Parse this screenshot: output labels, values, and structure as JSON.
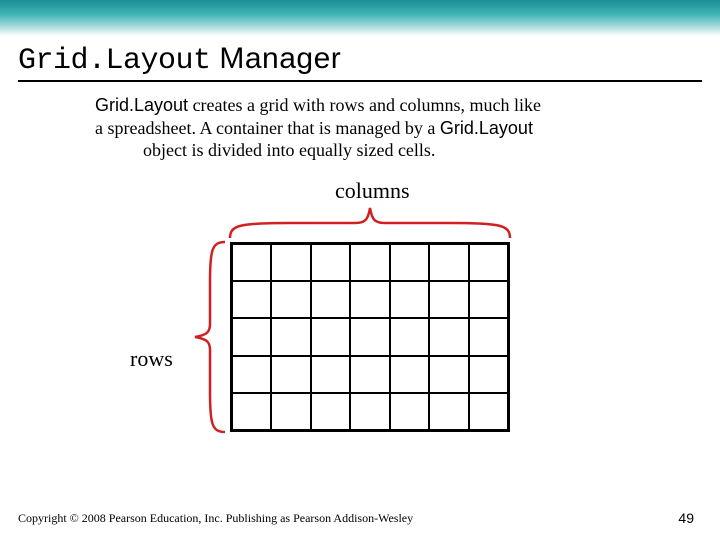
{
  "title": {
    "mono": "Grid.Layout",
    "rest": " Manager"
  },
  "body": {
    "l1a": "Grid.Layout",
    "l1b": " creates a grid with rows and columns, much like",
    "l2a": "a spreadsheet.  A container that is managed by a ",
    "l2b": "Grid.Layout",
    "l3": "object is divided into equally sized cells."
  },
  "labels": {
    "columns": "columns",
    "rows": "rows"
  },
  "grid": {
    "rows": 5,
    "cols": 7
  },
  "footer": "Copyright © 2008 Pearson Education, Inc. Publishing as Pearson Addison-Wesley",
  "page": "49"
}
